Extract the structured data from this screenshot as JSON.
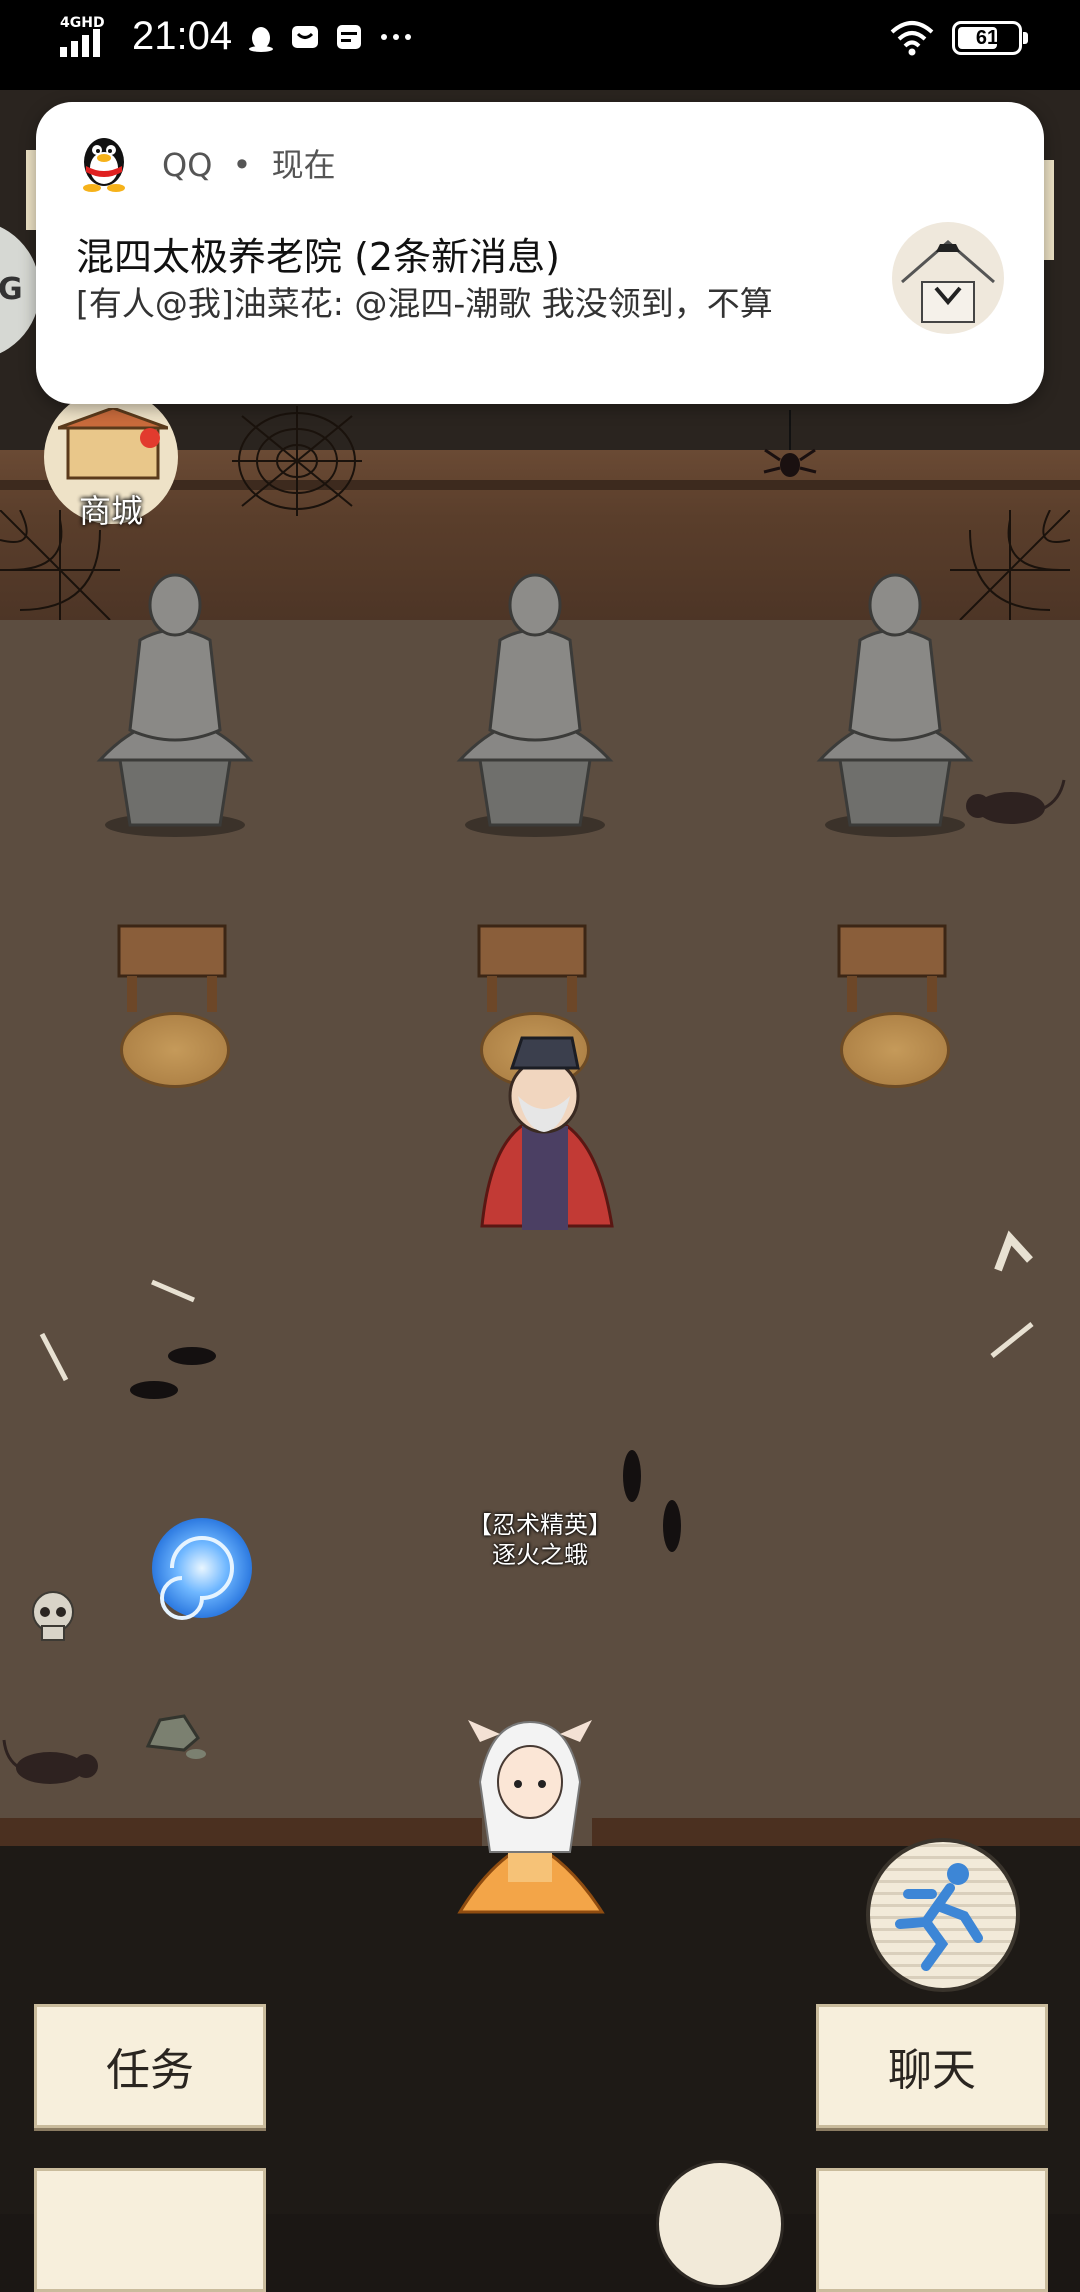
{
  "status_bar": {
    "network": "4GHD",
    "time": "21:04",
    "battery": "61",
    "battery_level": 0.61,
    "icons": [
      "qq-penguin-icon",
      "mail-icon",
      "card-icon",
      "more-icon",
      "wifi-icon"
    ]
  },
  "notification": {
    "app": "QQ",
    "separator": "•",
    "when": "现在",
    "title": "混四太极养老院 (2条新消息)",
    "body": "[有人@我]油菜花: @混四-潮歌 我没领到，不算"
  },
  "game": {
    "side_button": "G",
    "shop_label": "商城",
    "player_title": "【忍术精英】",
    "player_name": "逐火之蛾",
    "buttons": {
      "task": "任务",
      "chat": "聊天"
    }
  }
}
